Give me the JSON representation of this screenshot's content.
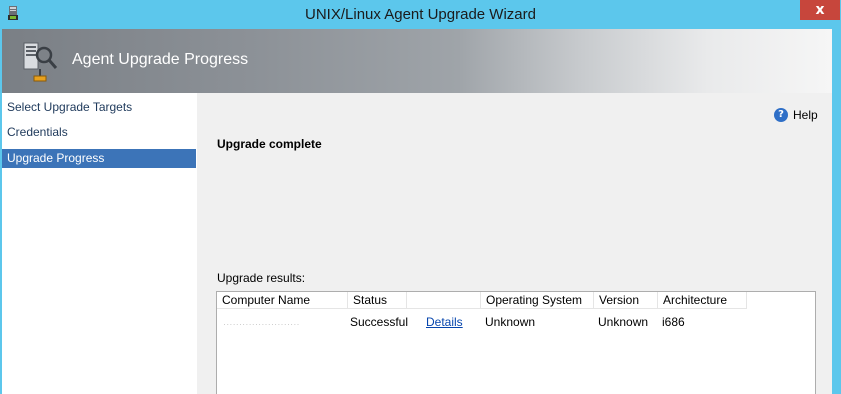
{
  "window": {
    "title": "UNIX/Linux Agent Upgrade Wizard",
    "close_glyph": "x",
    "icon": "wizard-app-icon"
  },
  "header": {
    "title": "Agent Upgrade Progress",
    "icon": "server-agent-icon"
  },
  "nav": {
    "items": [
      {
        "label": "Select Upgrade Targets",
        "selected": false
      },
      {
        "label": "Credentials",
        "selected": false
      },
      {
        "label": "Upgrade Progress",
        "selected": true
      }
    ]
  },
  "main": {
    "help_label": "Help",
    "help_icon": "help-icon",
    "status_heading": "Upgrade complete",
    "results_label": "Upgrade results:"
  },
  "results_table": {
    "columns": [
      "Computer Name",
      "Status",
      "",
      "Operating System",
      "Version",
      "Architecture"
    ],
    "rows": [
      {
        "computer_name": "························",
        "status": "Successful",
        "details_link": "Details",
        "operating_system": "Unknown",
        "version": "Unknown",
        "architecture": "i686"
      }
    ]
  },
  "colors": {
    "titlebar": "#5cc7ec",
    "close_button": "#c7463c",
    "nav_selected": "#3c74b8",
    "content_bg": "#f0f0f0",
    "link": "#0645ad"
  }
}
